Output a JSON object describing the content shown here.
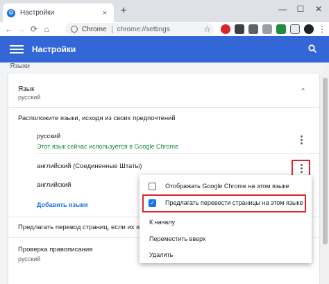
{
  "tab": {
    "title": "Настройки",
    "close": "×"
  },
  "toolbar": {
    "back": "←",
    "forward": "→",
    "reload": "⟳",
    "home": "⌂",
    "omnibox_site": "Chrome",
    "omnibox_url": "chrome://settings",
    "star": "☆"
  },
  "header": {
    "title": "Настройки"
  },
  "section": {
    "label": "Языки"
  },
  "language_block": {
    "title": "Язык",
    "current": "русский",
    "chevron": "⌃",
    "order_hint": "Расположите языки, исходя из своих предпочтений",
    "languages": [
      {
        "name": "русский",
        "note": "Этот язык сейчас используется в Google Chrome"
      },
      {
        "name": "английский (Соединенные Штаты)"
      },
      {
        "name": "английский"
      }
    ],
    "add_languages": "Добавить языки"
  },
  "translate_offer": {
    "label": "Предлагать перевод страниц, если их язык"
  },
  "spellcheck": {
    "title": "Проверка правописания",
    "value": "русский"
  },
  "menu": {
    "items": [
      {
        "label": "Отображать Google Chrome на этом языке",
        "checked": false
      },
      {
        "label": "Предлагать перевести страницы на этом языке",
        "checked": true
      },
      {
        "label": "К началу"
      },
      {
        "label": "Переместить вверх"
      },
      {
        "label": "Удалить"
      }
    ],
    "check_glyph": "✓"
  },
  "colors": {
    "header": "#3367d6",
    "highlight_red": "#d9262c",
    "accent_blue": "#1a73e8",
    "active_green": "#1e8e3e"
  }
}
